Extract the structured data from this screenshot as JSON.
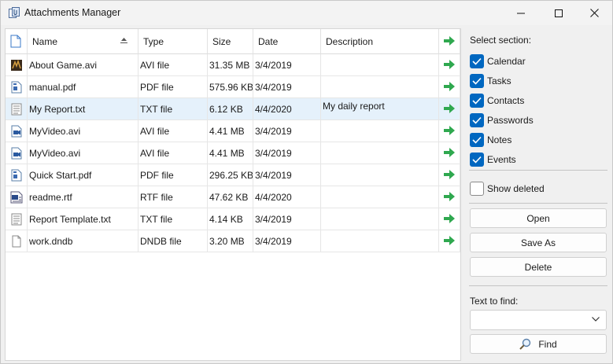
{
  "window": {
    "title": "Attachments Manager"
  },
  "grid": {
    "columns": [
      "Name",
      "Type",
      "Size",
      "Date",
      "Description"
    ],
    "rows": [
      {
        "name": "About Game.avi",
        "type": "AVI file",
        "size": "31.35 MB",
        "date": "3/4/2019",
        "description": "",
        "icon": "game-video-icon"
      },
      {
        "name": "manual.pdf",
        "type": "PDF file",
        "size": "575.96 KB",
        "date": "3/4/2019",
        "description": "",
        "icon": "pdf-file-icon"
      },
      {
        "name": "My Report.txt",
        "type": "TXT file",
        "size": "6.12 KB",
        "date": "4/4/2020",
        "description": "My daily report",
        "icon": "text-file-icon",
        "selected": true
      },
      {
        "name": "MyVideo.avi",
        "type": "AVI file",
        "size": "4.41 MB",
        "date": "3/4/2019",
        "description": "",
        "icon": "video-file-icon"
      },
      {
        "name": "MyVideo.avi",
        "type": "AVI file",
        "size": "4.41 MB",
        "date": "3/4/2019",
        "description": "",
        "icon": "video-file-icon"
      },
      {
        "name": "Quick Start.pdf",
        "type": "PDF file",
        "size": "296.25 KB",
        "date": "3/4/2019",
        "description": "",
        "icon": "pdf-file-icon"
      },
      {
        "name": "readme.rtf",
        "type": "RTF file",
        "size": "47.62 KB",
        "date": "4/4/2020",
        "description": "",
        "icon": "rtf-file-icon"
      },
      {
        "name": "Report Template.txt",
        "type": "TXT file",
        "size": "4.14 KB",
        "date": "3/4/2019",
        "description": "",
        "icon": "text-file-icon"
      },
      {
        "name": "work.dndb",
        "type": "DNDB file",
        "size": "3.20 MB",
        "date": "3/4/2019",
        "description": "",
        "icon": "blank-file-icon"
      }
    ]
  },
  "sidebar": {
    "select_section_label": "Select section:",
    "sections": [
      {
        "label": "Calendar",
        "checked": true
      },
      {
        "label": "Tasks",
        "checked": true
      },
      {
        "label": "Contacts",
        "checked": true
      },
      {
        "label": "Passwords",
        "checked": true
      },
      {
        "label": "Notes",
        "checked": true
      },
      {
        "label": "Events",
        "checked": true
      }
    ],
    "show_deleted": {
      "label": "Show deleted",
      "checked": false
    },
    "open_label": "Open",
    "save_as_label": "Save As",
    "delete_label": "Delete",
    "text_to_find_label": "Text to find:",
    "find_value": "",
    "find_label": "Find"
  },
  "colors": {
    "accent": "#0067c0",
    "selected_row": "#e5f1fb",
    "arrow_green": "#2fa84f"
  }
}
